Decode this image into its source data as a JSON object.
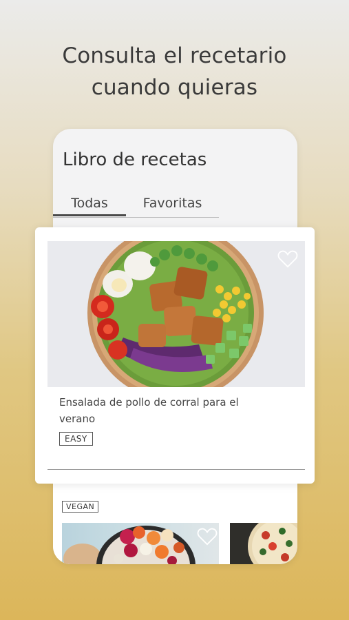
{
  "headline": {
    "line1": "Consulta el recetario",
    "line2": "cuando quieras"
  },
  "app": {
    "title": "Libro de recetas"
  },
  "tabs": [
    {
      "label": "Todas",
      "active": true
    },
    {
      "label": "Favoritas",
      "active": false
    }
  ],
  "featured_recipe": {
    "title": "Ensalada de pollo de corral para el verano",
    "badge": "EASY",
    "favorite_icon": "heart-outline-icon"
  },
  "next_recipe": {
    "badge": "VEGAN",
    "favorite_icon": "heart-outline-icon"
  },
  "colors": {
    "background_top": "#ebebea",
    "background_bottom": "#dcb65a",
    "text_dark": "#3a3a3a",
    "card_bg": "#ffffff",
    "phone_bg": "#f3f3f4"
  }
}
